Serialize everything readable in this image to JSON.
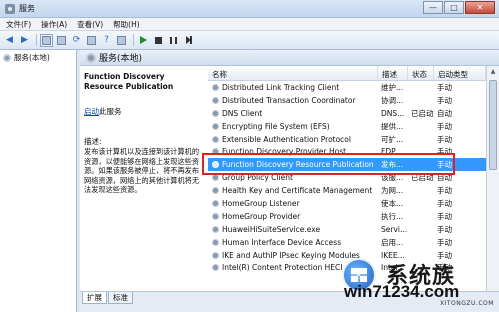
{
  "window": {
    "title": "服务",
    "minimize": "—",
    "maximize": "□",
    "close": "✕"
  },
  "menu": [
    "文件(F)",
    "操作(A)",
    "查看(V)",
    "帮助(H)"
  ],
  "tree": {
    "root": "服务(本地)"
  },
  "header": {
    "title": "服务(本地)"
  },
  "detail": {
    "service_name": "Function Discovery Resource Publication",
    "stop_link": "启动",
    "stop_suffix": "此服务",
    "desc_label": "描述:",
    "desc_text": "发布该计算机以及连接到该计算机的资源，以便能够在网络上发现这些资源。如果该服务被停止，将不再发布网络资源，网络上的其他计算机将无法发现这些资源。"
  },
  "columns": [
    "名称",
    "描述",
    "状态",
    "启动类型"
  ],
  "rows": [
    {
      "name": "Distributed Link Tracking Client",
      "desc": "维护...",
      "status": "",
      "start": "手动"
    },
    {
      "name": "Distributed Transaction Coordinator",
      "desc": "协调...",
      "status": "",
      "start": "手动"
    },
    {
      "name": "DNS Client",
      "desc": "DNS...",
      "status": "已启动",
      "start": "自动"
    },
    {
      "name": "Encrypting File System (EFS)",
      "desc": "提供...",
      "status": "",
      "start": "手动"
    },
    {
      "name": "Extensible Authentication Protocol",
      "desc": "可扩...",
      "status": "",
      "start": "手动"
    },
    {
      "name": "Function Discovery Provider Host",
      "desc": "FDP...",
      "status": "",
      "start": "手动"
    },
    {
      "name": "Function Discovery Resource Publication",
      "desc": "发布...",
      "status": "",
      "start": "手动"
    },
    {
      "name": "Group Policy Client",
      "desc": "该服...",
      "status": "已启动",
      "start": "自动"
    },
    {
      "name": "Health Key and Certificate Management",
      "desc": "为网...",
      "status": "",
      "start": "手动"
    },
    {
      "name": "HomeGroup Listener",
      "desc": "使本...",
      "status": "",
      "start": "手动"
    },
    {
      "name": "HomeGroup Provider",
      "desc": "执行...",
      "status": "",
      "start": "手动"
    },
    {
      "name": "HuaweiHiSuiteService.exe",
      "desc": "Servi...",
      "status": "",
      "start": "手动"
    },
    {
      "name": "Human Interface Device Access",
      "desc": "启用...",
      "status": "",
      "start": "手动"
    },
    {
      "name": "IKE and AuthIP IPsec Keying Modules",
      "desc": "IKEE...",
      "status": "",
      "start": "手动"
    },
    {
      "name": "Intel(R) Content Protection HECI Service",
      "desc": "Intel...",
      "status": "",
      "start": "手动"
    }
  ],
  "tabs": [
    "扩展",
    "标准"
  ],
  "watermark": {
    "brand": "系统族",
    "url": "win71234.com",
    "small": "XITONGZU.COM"
  }
}
